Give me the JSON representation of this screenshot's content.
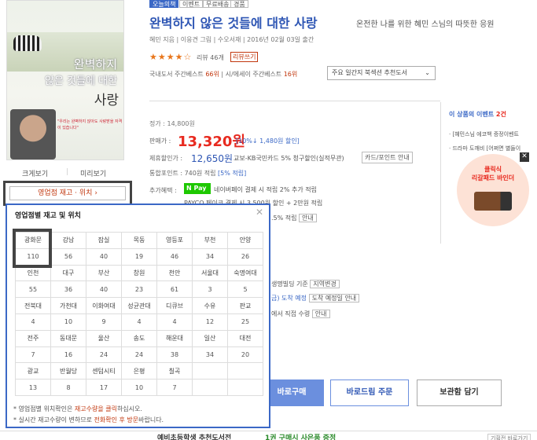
{
  "badges": [
    "오늘의책",
    "이벤트",
    "무료배송",
    "경품"
  ],
  "book": {
    "title": "완벽하지 않은 것들에 대한 사랑",
    "subtitle": "온전한 나를 위한 혜민 스님의 따뜻한 응원",
    "byline": "혜민 지음 | 이응견 그림 | 수오서재 | 2016년 02월 03일 출간",
    "stars": "★★★★☆",
    "review_count": "리뷰 46개",
    "review_button": "리뷰쓰기",
    "bestseller_prefix": "국내도서 주간베스트",
    "bestseller_rank1": "66위",
    "bestseller_mid": " | 시/에세이 주간베스트",
    "bestseller_rank2": "16위",
    "recommend_select": "주요 일간지 북섹션 추천도서"
  },
  "cover": {
    "title_line1": "완벽하지",
    "title_line2": "않은 것들에 대한",
    "title_line3": "사랑",
    "blurb": "\"우리는 완벽하지 않아도 사랑받을 자격이 있습니다\"",
    "tab_big": "크게보기",
    "tab_preview": "미리보기"
  },
  "stock_button": "영업점 재고 · 위치  ›",
  "popup": {
    "title": "영업점별 재고 및 위치",
    "close": "✕",
    "rows": [
      {
        "names": [
          "광화문",
          "강남",
          "잠실",
          "목동",
          "영등포",
          "부천",
          "안양"
        ],
        "counts": [
          "110",
          "56",
          "40",
          "19",
          "46",
          "34",
          "26"
        ]
      },
      {
        "names": [
          "인천",
          "대구",
          "부산",
          "창원",
          "천안",
          "서울대",
          "숙명여대"
        ],
        "counts": [
          "55",
          "36",
          "40",
          "23",
          "61",
          "3",
          "5"
        ]
      },
      {
        "names": [
          "전북대",
          "가천대",
          "이화여대",
          "성균관대",
          "디큐브",
          "수유",
          "판교"
        ],
        "counts": [
          "4",
          "10",
          "9",
          "4",
          "4",
          "12",
          "25"
        ]
      },
      {
        "names": [
          "전주",
          "동대문",
          "울산",
          "송도",
          "해운대",
          "일산",
          "대전"
        ],
        "counts": [
          "7",
          "16",
          "24",
          "24",
          "38",
          "34",
          "20"
        ]
      },
      {
        "names": [
          "광교",
          "반월당",
          "센텀시티",
          "은평",
          "칠곡",
          "",
          ""
        ],
        "counts": [
          "13",
          "8",
          "17",
          "10",
          "7",
          "",
          ""
        ]
      }
    ],
    "note1_prefix": "* 영업점별 위치확인은 ",
    "note1_em": "재고수량을 클릭",
    "note1_suffix": "하십시오.",
    "note2_prefix": "* 실시간 재고수량이 변하므로 ",
    "note2_em": "전화확인 후 방문",
    "note2_suffix": "바랍니다."
  },
  "price": {
    "list": "정가 : 14,800원",
    "sale_label": "판매가 :",
    "sale_price": "13,320원",
    "sale_discount": "[10%↓ 1,480원 할인]",
    "disc_label": "제휴할인가 :",
    "disc_price": "12,650원",
    "disc_desc": "교보-KB국민카드 5% 청구할인(실적무관)",
    "card_button": "카드/포인트 안내",
    "points_prefix": "통합포인트 :",
    "points_value": "740원 적립",
    "points_pct": "[5% 적립]",
    "extra_label": "추가혜택 :",
    "npay_badge": "N Pay",
    "npay_text": "네이버페이 결제 시 적립 2% 추가 적립",
    "payco_text": "PAYCO 페이코 결제 시 3,500원 할인 + 2만원 적립",
    "extra_row3": ".5% 적립",
    "extra_row3_btn": "안내"
  },
  "delivery": {
    "line1": "생명빌딩 기준",
    "line1_btn": "지역변경",
    "line2": "금) 도착 예정",
    "line2_btn": "도착 예정일 안내",
    "line3": "에서 직접 수령",
    "line3_btn": "안내"
  },
  "buttons": {
    "buy": "바로구매",
    "baro": "바로드림 주문",
    "basket": "보관함 담기"
  },
  "event_panel": {
    "title_prefix": "이 상품의 이벤트",
    "title_count": "2건",
    "item1": "· [혜민스님 에코백 증정이벤트",
    "item2": "· 드라마 도깨비 [어쩌면 별들이",
    "close": "✕",
    "circle_line1": "클릭식",
    "circle_line2": "리갈패드 바인더"
  },
  "bottom": {
    "title": "예비초등학생 추천도서전",
    "event": "1권 구매시 사은품 증정",
    "more": "기획전 바로가기"
  }
}
